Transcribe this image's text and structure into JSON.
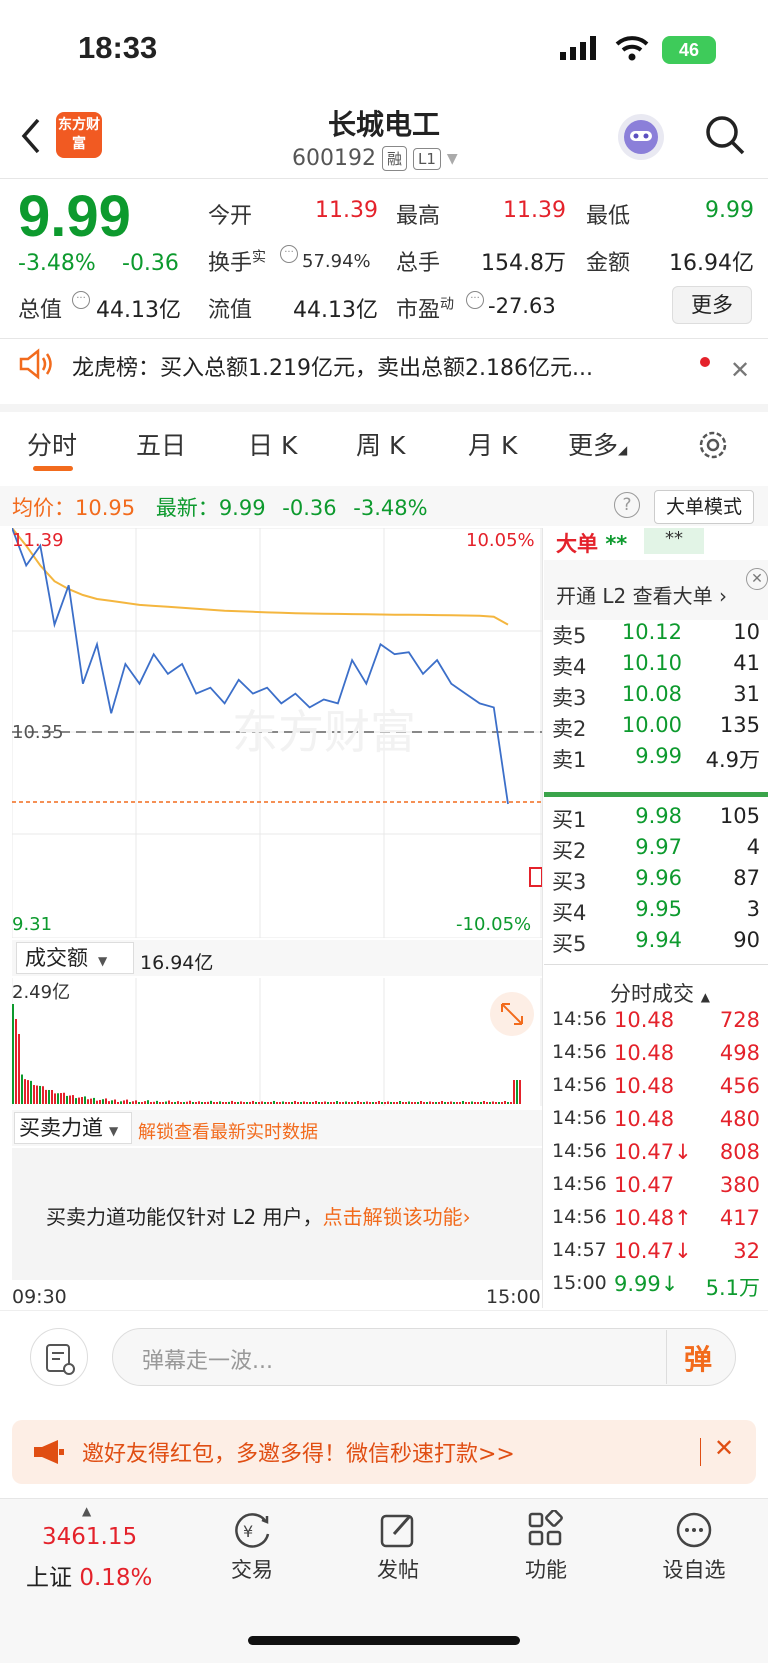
{
  "status": {
    "time": "18:33",
    "battery": "46"
  },
  "header": {
    "back_icon": "chevron-left-icon",
    "logo_text": "东方财富",
    "stock_name": "长城电工",
    "stock_code": "600192",
    "tag_margin": "融",
    "tag_level": "L1"
  },
  "quote": {
    "price": "9.99",
    "change_pct": "-3.48%",
    "change": "-0.36",
    "open_label": "今开",
    "open": "11.39",
    "high_label": "最高",
    "high": "11.39",
    "low_label": "最低",
    "low": "9.99",
    "turnover_label": "换手",
    "turnover_sup": "实",
    "turnover": "57.94%",
    "volume_label": "总手",
    "volume": "154.8万",
    "amount_label": "金额",
    "amount": "16.94亿",
    "total_mv_label": "总值",
    "total_mv": "44.13亿",
    "float_mv_label": "流值",
    "float_mv": "44.13亿",
    "pe_label": "市盈",
    "pe_sup": "动",
    "pe": "-27.63",
    "more": "更多"
  },
  "notice": {
    "text": "龙虎榜：买入总额1.219亿元，卖出总额2.186亿元..."
  },
  "tabs": [
    "分时",
    "五日",
    "日 K",
    "周 K",
    "月 K",
    "更多"
  ],
  "chart_info": {
    "avg_label": "均价：",
    "avg": "10.95",
    "latest_label": "最新：",
    "latest": "9.99",
    "latest_chg": "-0.36",
    "latest_pct": "-3.48%",
    "big_order_mode": "大单模式"
  },
  "chart_data": {
    "type": "line",
    "y_max_label": "11.39",
    "y_max_pct": "10.05%",
    "y_mid_label": "10.35",
    "y_min_label": "9.31",
    "y_min_pct": "-10.05%",
    "ylim": [
      9.31,
      11.39
    ],
    "prev_close": 10.35,
    "time_start": "09:30",
    "time_end": "15:00",
    "series": [
      {
        "values": [
          11.39,
          11.2,
          11.3,
          10.9,
          11.1,
          10.6,
          10.8,
          10.45,
          10.7,
          10.6,
          10.75,
          10.65,
          10.7,
          10.55,
          10.58,
          10.5,
          10.62,
          10.55,
          10.58,
          10.5,
          10.55,
          10.48,
          10.52,
          10.5,
          10.72,
          10.6,
          10.8,
          10.75,
          10.76,
          10.65,
          10.72,
          10.6,
          10.55,
          10.5,
          10.48,
          9.99
        ]
      },
      {
        "values": [
          11.39,
          11.3,
          11.2,
          11.12,
          11.08,
          11.05,
          11.03,
          11.02,
          11.01,
          11.0,
          10.995,
          10.99,
          10.985,
          10.98,
          10.975,
          10.97,
          10.968,
          10.965,
          10.962,
          10.96,
          10.958,
          10.956,
          10.955,
          10.954,
          10.953,
          10.952,
          10.951,
          10.95,
          10.95,
          10.949,
          10.948,
          10.947,
          10.946,
          10.945,
          10.94,
          10.9
        ]
      }
    ]
  },
  "volume_panel": {
    "selector": "成交额",
    "total": "16.94亿",
    "max_label": "2.49亿"
  },
  "power_panel": {
    "selector": "买卖力道",
    "unlock_hint": "解锁查看最新实时数据",
    "message": "买卖力道功能仅针对 L2 用户，",
    "unlock_link": "点击解锁该功能"
  },
  "right_panel": {
    "big_order": "大单",
    "stars1": "**",
    "stars2": "**",
    "l2_link": "开通 L2 查看大单",
    "asks": [
      {
        "label": "卖5",
        "price": "10.12",
        "vol": "10"
      },
      {
        "label": "卖4",
        "price": "10.10",
        "vol": "41"
      },
      {
        "label": "卖3",
        "price": "10.08",
        "vol": "31"
      },
      {
        "label": "卖2",
        "price": "10.00",
        "vol": "135"
      },
      {
        "label": "卖1",
        "price": "9.99",
        "vol": "4.9万"
      }
    ],
    "bids": [
      {
        "label": "买1",
        "price": "9.98",
        "vol": "105"
      },
      {
        "label": "买2",
        "price": "9.97",
        "vol": "4"
      },
      {
        "label": "买3",
        "price": "9.96",
        "vol": "87"
      },
      {
        "label": "买4",
        "price": "9.95",
        "vol": "3"
      },
      {
        "label": "买5",
        "price": "9.94",
        "vol": "90"
      }
    ],
    "ticks_title": "分时成交",
    "ticks": [
      {
        "time": "14:56",
        "price": "10.48",
        "vol": "728",
        "dir": "up"
      },
      {
        "time": "14:56",
        "price": "10.48",
        "vol": "498",
        "dir": "up"
      },
      {
        "time": "14:56",
        "price": "10.48",
        "vol": "456",
        "dir": "up"
      },
      {
        "time": "14:56",
        "price": "10.48",
        "vol": "480",
        "dir": "up"
      },
      {
        "time": "14:56",
        "price": "10.47↓",
        "vol": "808",
        "dir": "up"
      },
      {
        "time": "14:56",
        "price": "10.47",
        "vol": "380",
        "dir": "up"
      },
      {
        "time": "14:56",
        "price": "10.48↑",
        "vol": "417",
        "dir": "up"
      },
      {
        "time": "14:57",
        "price": "10.47↓",
        "vol": "32",
        "dir": "up"
      },
      {
        "time": "15:00",
        "price": "9.99↓",
        "vol": "5.1万",
        "dir": "down"
      }
    ]
  },
  "danmu": {
    "placeholder": "弹幕走一波...",
    "send": "弹"
  },
  "promo": {
    "text": "邀好友得红包，多邀多得！微信秒速打款>>"
  },
  "bottom_nav": {
    "index_value": "3461.15",
    "index_name": "上证",
    "index_pct": "0.18%",
    "items": [
      "交易",
      "发帖",
      "功能",
      "设自选"
    ]
  }
}
